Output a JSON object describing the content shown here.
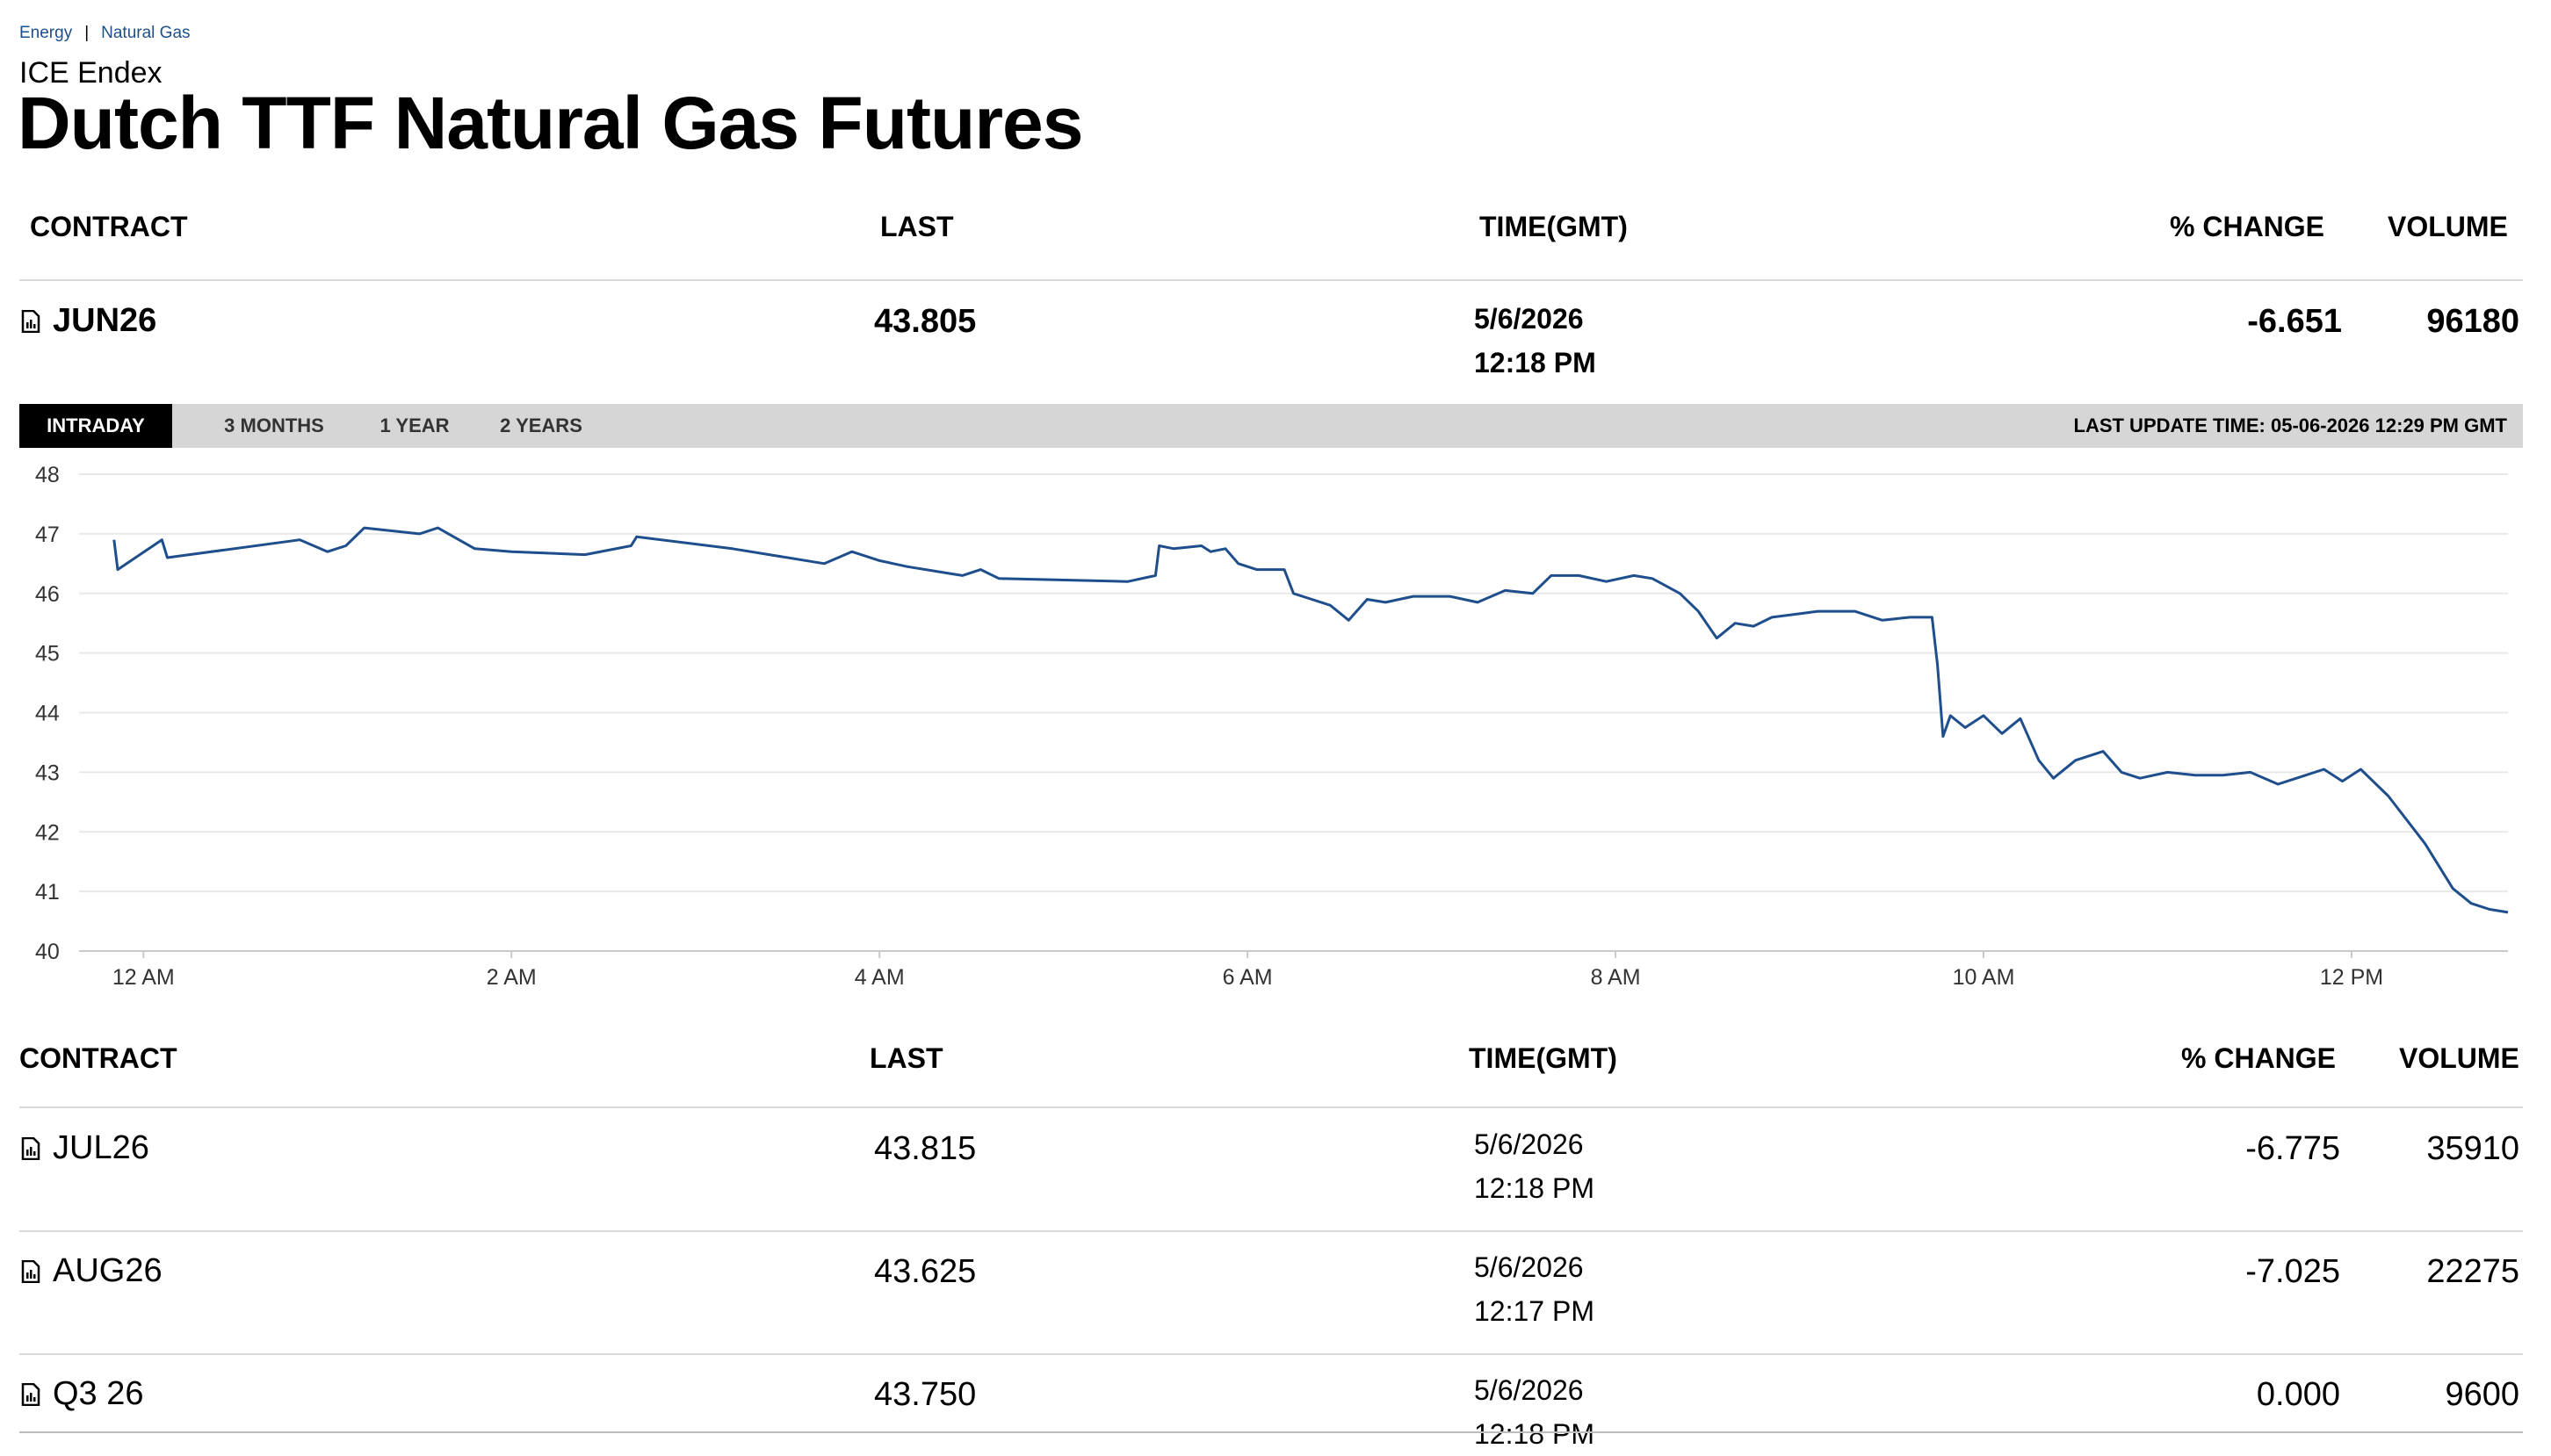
{
  "breadcrumb": {
    "item1": "Energy",
    "separator": "|",
    "item2": "Natural Gas"
  },
  "exchange": "ICE Endex",
  "title": "Dutch TTF Natural Gas Futures",
  "columns": {
    "contract": "CONTRACT",
    "last": "LAST",
    "time": "TIME(GMT)",
    "change": "% CHANGE",
    "volume": "VOLUME"
  },
  "front_contract": {
    "name": "JUN26",
    "last": "43.805",
    "date": "5/6/2026",
    "time": "12:18 PM",
    "change": "-6.651",
    "volume": "96180"
  },
  "tabs": [
    "INTRADAY",
    "3 MONTHS",
    "1 YEAR",
    "2 YEARS"
  ],
  "active_tab": "INTRADAY",
  "last_update": "LAST UPDATE TIME: 05-06-2026 12:29 PM GMT",
  "colors": {
    "line": "#1f4e8c",
    "link": "#1f4e8c",
    "tab_active": "#000000",
    "tab_bar": "#d6d6d6"
  },
  "icons": {
    "contract": "chart-document-icon"
  },
  "chart_data": {
    "type": "line",
    "x_unit": "hours since 12 AM GMT",
    "xlim": [
      -0.35,
      12.85
    ],
    "ylim": [
      40,
      48
    ],
    "y_ticks": [
      "48",
      "47",
      "46",
      "45",
      "44",
      "43",
      "42",
      "41",
      "40"
    ],
    "x_ticks": [
      {
        "x": 0,
        "label": "12 AM"
      },
      {
        "x": 2,
        "label": "2 AM"
      },
      {
        "x": 4,
        "label": "4 AM"
      },
      {
        "x": 6,
        "label": "6 AM"
      },
      {
        "x": 8,
        "label": "8 AM"
      },
      {
        "x": 10,
        "label": "10 AM"
      },
      {
        "x": 12,
        "label": "12 PM"
      }
    ],
    "grid": true,
    "series": [
      {
        "points": [
          [
            -0.16,
            46.9
          ],
          [
            -0.14,
            46.4
          ],
          [
            0.1,
            46.9
          ],
          [
            0.13,
            46.6
          ],
          [
            0.85,
            46.9
          ],
          [
            1.0,
            46.7
          ],
          [
            1.1,
            46.8
          ],
          [
            1.2,
            47.1
          ],
          [
            1.5,
            47.0
          ],
          [
            1.6,
            47.1
          ],
          [
            1.8,
            46.75
          ],
          [
            2.0,
            46.7
          ],
          [
            2.4,
            46.65
          ],
          [
            2.65,
            46.8
          ],
          [
            2.68,
            46.95
          ],
          [
            3.2,
            46.75
          ],
          [
            3.7,
            46.5
          ],
          [
            3.85,
            46.7
          ],
          [
            4.0,
            46.55
          ],
          [
            4.15,
            46.45
          ],
          [
            4.35,
            46.35
          ],
          [
            4.45,
            46.3
          ],
          [
            4.55,
            46.4
          ],
          [
            4.65,
            46.25
          ],
          [
            5.35,
            46.2
          ],
          [
            5.5,
            46.3
          ],
          [
            5.52,
            46.8
          ],
          [
            5.6,
            46.75
          ],
          [
            5.75,
            46.8
          ],
          [
            5.8,
            46.7
          ],
          [
            5.88,
            46.75
          ],
          [
            5.95,
            46.5
          ],
          [
            6.05,
            46.4
          ],
          [
            6.2,
            46.4
          ],
          [
            6.25,
            46.0
          ],
          [
            6.35,
            45.9
          ],
          [
            6.45,
            45.8
          ],
          [
            6.55,
            45.55
          ],
          [
            6.65,
            45.9
          ],
          [
            6.75,
            45.85
          ],
          [
            6.9,
            45.95
          ],
          [
            7.1,
            45.95
          ],
          [
            7.25,
            45.85
          ],
          [
            7.4,
            46.05
          ],
          [
            7.55,
            46.0
          ],
          [
            7.65,
            46.3
          ],
          [
            7.8,
            46.3
          ],
          [
            7.95,
            46.2
          ],
          [
            8.1,
            46.3
          ],
          [
            8.2,
            46.25
          ],
          [
            8.35,
            46.0
          ],
          [
            8.45,
            45.7
          ],
          [
            8.55,
            45.25
          ],
          [
            8.65,
            45.5
          ],
          [
            8.75,
            45.45
          ],
          [
            8.85,
            45.6
          ],
          [
            9.1,
            45.7
          ],
          [
            9.3,
            45.7
          ],
          [
            9.45,
            45.55
          ],
          [
            9.6,
            45.6
          ],
          [
            9.72,
            45.6
          ],
          [
            9.75,
            44.8
          ],
          [
            9.78,
            43.6
          ],
          [
            9.82,
            43.95
          ],
          [
            9.9,
            43.75
          ],
          [
            10.0,
            43.95
          ],
          [
            10.1,
            43.65
          ],
          [
            10.2,
            43.9
          ],
          [
            10.3,
            43.2
          ],
          [
            10.38,
            42.9
          ],
          [
            10.5,
            43.2
          ],
          [
            10.65,
            43.35
          ],
          [
            10.75,
            43.0
          ],
          [
            10.85,
            42.9
          ],
          [
            11.0,
            43.0
          ],
          [
            11.15,
            42.95
          ],
          [
            11.3,
            42.95
          ],
          [
            11.45,
            43.0
          ],
          [
            11.6,
            42.8
          ],
          [
            11.75,
            42.95
          ],
          [
            11.85,
            43.05
          ],
          [
            11.95,
            42.85
          ],
          [
            12.05,
            43.05
          ],
          [
            12.2,
            42.6
          ],
          [
            12.3,
            42.2
          ],
          [
            12.4,
            41.8
          ],
          [
            12.55,
            41.05
          ],
          [
            12.65,
            40.8
          ],
          [
            12.75,
            40.7
          ],
          [
            12.85,
            40.65
          ]
        ]
      }
    ]
  },
  "contracts": [
    {
      "name": "JUL26",
      "last": "43.815",
      "date": "5/6/2026",
      "time": "12:18 PM",
      "change": "-6.775",
      "volume": "35910"
    },
    {
      "name": "AUG26",
      "last": "43.625",
      "date": "5/6/2026",
      "time": "12:17 PM",
      "change": "-7.025",
      "volume": "22275"
    },
    {
      "name": "Q3 26",
      "last": "43.750",
      "date": "5/6/2026",
      "time": "12:18 PM",
      "change": "0.000",
      "volume": "9600"
    }
  ]
}
